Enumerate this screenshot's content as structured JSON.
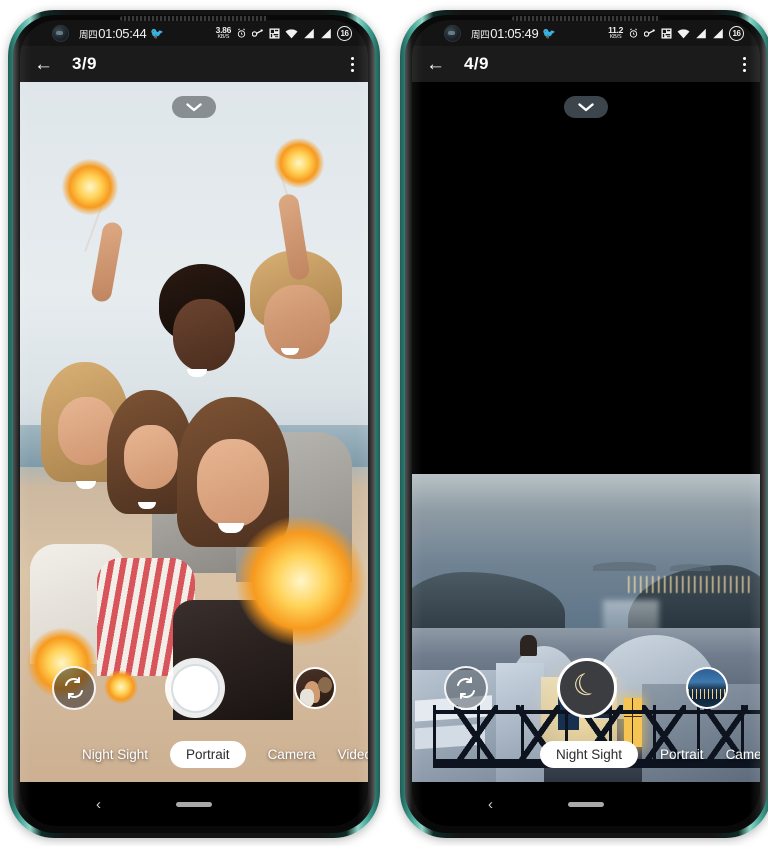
{
  "phones": [
    {
      "id": "left",
      "status_bar": {
        "camera_hole": "front-camera-hole",
        "day": "周四",
        "clock": "01:05:44",
        "bird_icon": "🐦",
        "net_speed_value": "3.86",
        "net_speed_unit": "KB/S",
        "alarm_icon": "alarm-clock-icon",
        "vpn_icon": "vpn-key-icon",
        "nfc_icon": "nfc-icon",
        "wifi_icon": "wifi-icon",
        "signal_icon_1": "signal-bars-icon",
        "signal_icon_2": "signal-bars-icon",
        "battery_level": "16"
      },
      "app_bar": {
        "back_icon": "←",
        "title": "3/9",
        "overflow_icon": "overflow-menu-icon"
      },
      "viewfinder": {
        "scene_description": "group-selfie-sparklers-beach",
        "chevron_icon": "chevron-down-icon",
        "flip_camera_icon": "flip-camera-icon",
        "shutter_icon": "shutter-button",
        "thumbnail_description": "woman-with-dog-thumbnail"
      },
      "modes": [
        {
          "label": "Night Sight",
          "active": false
        },
        {
          "label": "Portrait",
          "active": true
        },
        {
          "label": "Camera",
          "active": false
        },
        {
          "label": "Video",
          "active": false
        }
      ],
      "nav_bar": {
        "back_icon": "‹",
        "home_indicator": "home-pill-indicator"
      }
    },
    {
      "id": "right",
      "status_bar": {
        "camera_hole": "front-camera-hole",
        "day": "周四",
        "clock": "01:05:49",
        "bird_icon": "🐦",
        "net_speed_value": "11.2",
        "net_speed_unit": "KB/S",
        "alarm_icon": "alarm-clock-icon",
        "vpn_icon": "vpn-key-icon",
        "nfc_icon": "nfc-icon",
        "wifi_icon": "wifi-icon",
        "signal_icon_1": "signal-bars-icon",
        "signal_icon_2": "signal-bars-icon",
        "battery_level": "16"
      },
      "app_bar": {
        "back_icon": "←",
        "title": "4/9",
        "overflow_icon": "overflow-menu-icon"
      },
      "viewfinder": {
        "scene_description": "santorini-sunset-seascape",
        "chevron_icon": "chevron-down-icon",
        "flip_camera_icon": "flip-camera-icon",
        "shutter_icon": "crescent-moon-shutter",
        "shutter_glyph": "☾",
        "thumbnail_description": "night-cityscape-thumbnail"
      },
      "modes": [
        {
          "label": "Night Sight",
          "active": true
        },
        {
          "label": "Portrait",
          "active": false
        },
        {
          "label": "Camera",
          "active": false
        }
      ],
      "nav_bar": {
        "back_icon": "‹",
        "home_indicator": "home-pill-indicator"
      }
    }
  ],
  "colors": {
    "frame_teal": "#3fa294",
    "status_bar_bg": "#141414",
    "app_bar_bg": "#1b1b1b",
    "nav_bar_bg": "#000000",
    "mode_active_bg": "#ffffff",
    "moon_glyph": "#f2e2b4"
  }
}
